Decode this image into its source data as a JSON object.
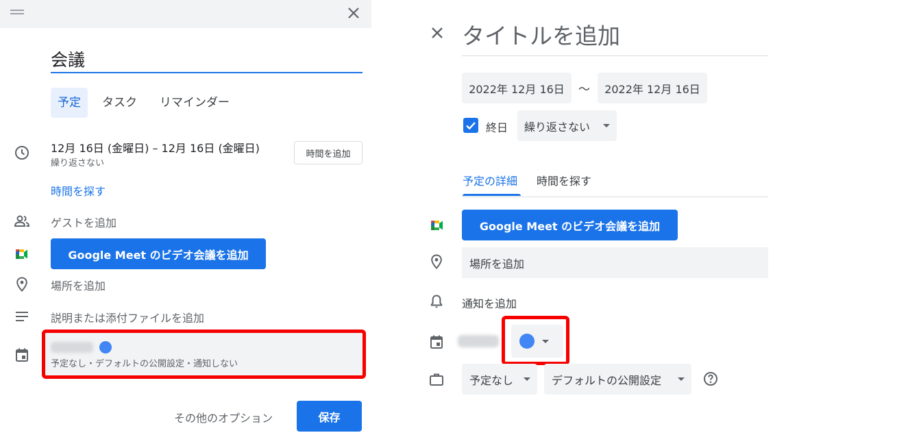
{
  "left_panel": {
    "title_value": "会議",
    "type_tabs": [
      "予定",
      "タスク",
      "リマインダー"
    ],
    "date_range": "12月 16日 (金曜日)  –  12月 16日 (金曜日)",
    "repeat_text": "繰り返さない",
    "add_time_label": "時間を追加",
    "find_time_link": "時間を探す",
    "add_guests": "ゲストを追加",
    "meet_button_label": "Google Meet のビデオ会議を追加",
    "add_location": "場所を追加",
    "add_description": "説明または添付ファイルを追加",
    "calendar_summary": "予定なし・デフォルトの公開設定・通知しない",
    "more_options_label": "その他のオプション",
    "save_label": "保存"
  },
  "right_panel": {
    "title_placeholder": "タイトルを追加",
    "start_date": "2022年 12月 16日",
    "date_separator": "～",
    "end_date": "2022年 12月 16日",
    "all_day_label": "終日",
    "all_day_checked": true,
    "repeat_value": "繰り返さない",
    "tabs": [
      "予定の詳細",
      "時間を探す"
    ],
    "meet_button_label": "Google Meet のビデオ会議を追加",
    "location_placeholder": "場所を追加",
    "add_notification": "通知を追加",
    "busy_value": "予定なし",
    "visibility_value": "デフォルトの公開設定"
  },
  "colors": {
    "accent": "#1a73e8",
    "calendar_color": "#4285f4",
    "highlight": "#f70000"
  },
  "icons": [
    "drag-handle-icon",
    "close-icon",
    "clock-icon",
    "people-icon",
    "google-meet-icon",
    "location-pin-icon",
    "notes-icon",
    "calendar-icon",
    "bell-icon",
    "briefcase-icon",
    "help-icon",
    "checkmark-icon",
    "dropdown-caret-icon"
  ]
}
